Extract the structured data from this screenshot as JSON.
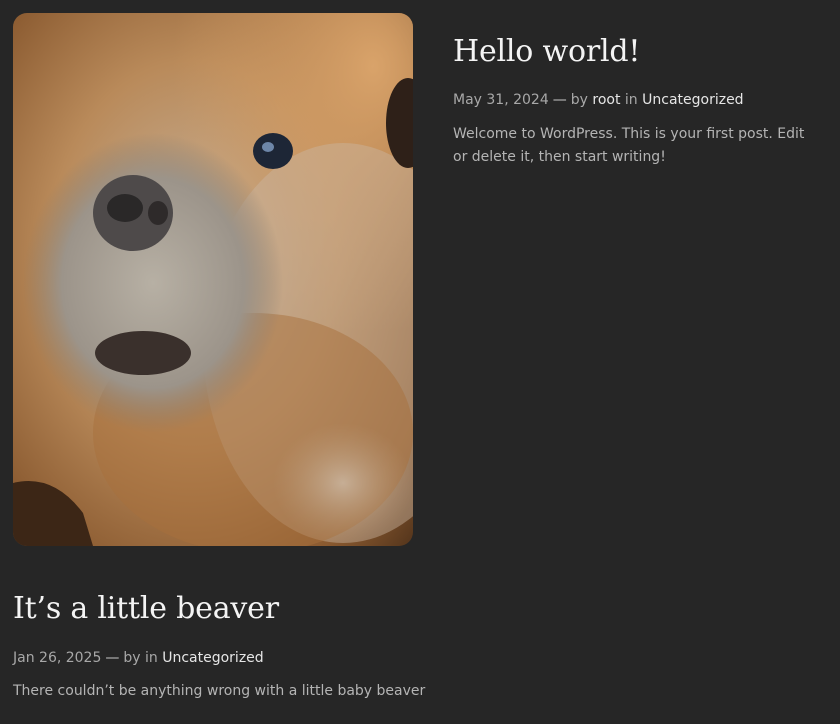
{
  "posts": [
    {
      "title": "Hello world!",
      "date": "May 31, 2024",
      "dash": "—",
      "by": "by",
      "author": "root",
      "in": "in",
      "category": "Uncategorized",
      "excerpt": "Welcome to WordPress. This is your first post. Edit or delete it, then start writing!"
    },
    {
      "title": "It’s a little beaver",
      "date": "Jan 26, 2025",
      "dash": "—",
      "by": "by",
      "in": "in",
      "category": "Uncategorized",
      "excerpt": "There couldn’t be anything wrong with a little baby beaver",
      "image_subject": "beaver-photo"
    }
  ],
  "colors": {
    "background": "#262626",
    "title": "#f4f4f4",
    "meta": "#a8a8a8",
    "link": "#e6e6e6"
  }
}
